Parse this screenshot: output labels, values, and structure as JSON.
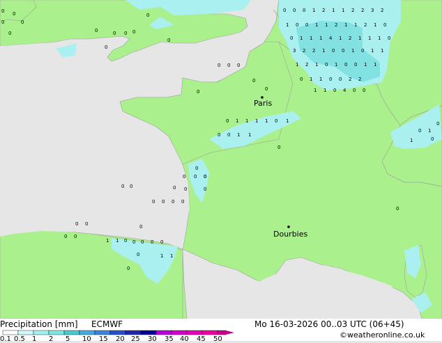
{
  "map": {
    "cities": [
      {
        "name": "Paris"
      },
      {
        "name": "Dourbies"
      }
    ],
    "precip_values": {
      "benelux": [
        "0",
        "0",
        "0",
        "1",
        "2",
        "1",
        "1",
        "2",
        "2",
        "3",
        "2",
        "1",
        "0",
        "0",
        "1",
        "1",
        "2",
        "1",
        "1",
        "2",
        "1",
        "0",
        "0",
        "1",
        "1",
        "1",
        "4",
        "1",
        "2",
        "1",
        "1",
        "1",
        "0",
        "3",
        "2",
        "2",
        "1",
        "0",
        "0",
        "1",
        "0",
        "1",
        "1",
        "1",
        "2",
        "1",
        "0",
        "1",
        "0",
        "0",
        "1",
        "1",
        "0",
        "1",
        "1",
        "0",
        "0",
        "2",
        "2",
        "1",
        "1",
        "0",
        "4",
        "0",
        "0",
        "0",
        "0",
        "0",
        "0",
        "0",
        "1",
        "1",
        "0",
        "0",
        "0",
        "0",
        "0"
      ],
      "england": [
        "0",
        "0",
        "0",
        "0",
        "0",
        "0",
        "0",
        "0",
        "0",
        "0",
        "0",
        "0",
        "0",
        "0",
        "0",
        "0",
        "0",
        "0"
      ],
      "central_france": [
        "0",
        "1",
        "1",
        "1",
        "1",
        "0",
        "1",
        "0",
        "0",
        "1",
        "1",
        "0",
        "0",
        "0"
      ],
      "atlantic_coast": [
        "0",
        "0",
        "0",
        "0",
        "0",
        "0",
        "0",
        "0",
        "0",
        "0",
        "0",
        "0"
      ],
      "pyrenees": [
        "0",
        "0",
        "0",
        "0",
        "0",
        "1",
        "1",
        "0",
        "0",
        "0",
        "0",
        "0",
        "1",
        "1",
        "0",
        "0"
      ],
      "alps": [
        "1",
        "0",
        "1",
        "0",
        "0",
        "0"
      ]
    }
  },
  "legend": {
    "title": "Precipitation [mm]",
    "model": "ECMWF",
    "ticks": [
      "0.1",
      "0.5",
      "1",
      "2",
      "5",
      "10",
      "15",
      "20",
      "25",
      "30",
      "35",
      "40",
      "45",
      "50"
    ],
    "colors": [
      "#ffffff",
      "#d2fafa",
      "#a4f0f0",
      "#82e6e6",
      "#4bc8d2",
      "#46aadc",
      "#3c82dc",
      "#2850c8",
      "#1e28aa",
      "#000096",
      "#b400dc",
      "#d200c8",
      "#e600b4",
      "#f000a0",
      "#c8008c"
    ]
  },
  "footer": {
    "datetime": "Mo 16-03-2026 00..03 UTC (06+45)",
    "credit": "©weatheronline.co.uk"
  },
  "colors": {
    "land": "#aaf08c",
    "sea": "#e6e6e6",
    "precip_light": "#aaf0f0",
    "precip_mid": "#82e1e1",
    "border": "#a0a0a0"
  }
}
